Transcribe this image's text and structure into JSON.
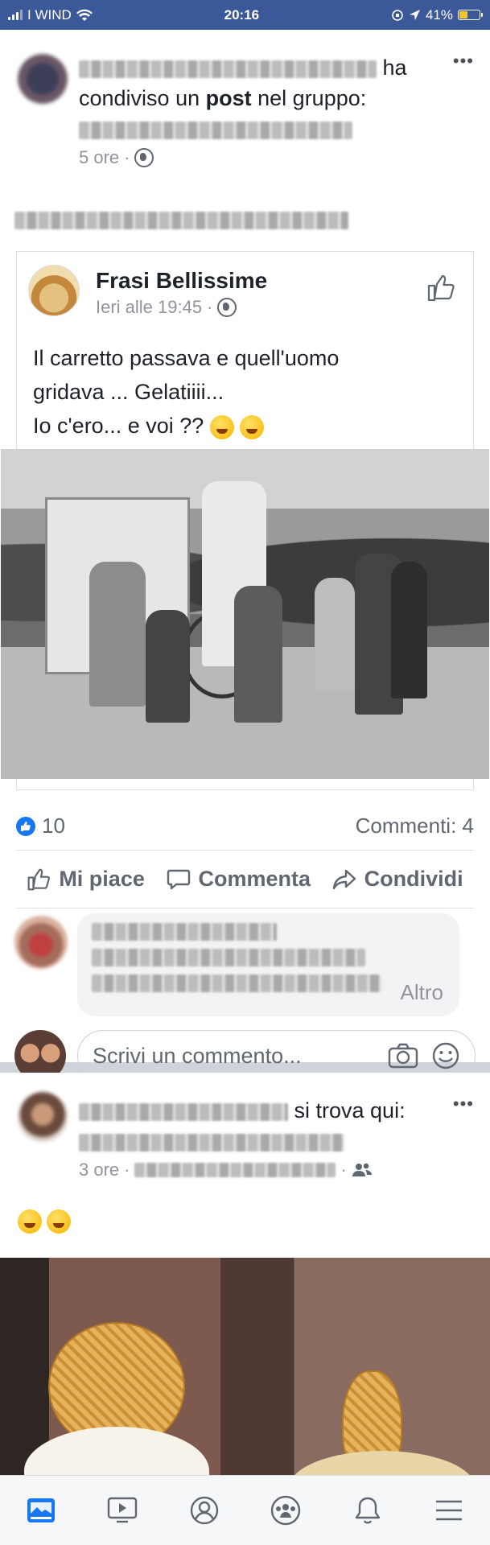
{
  "status_bar": {
    "carrier": "I WIND",
    "time": "20:16",
    "battery": "41%"
  },
  "post1": {
    "shared_action": "ha",
    "shared_line2_prefix": "condiviso un",
    "shared_line2_bold": "post",
    "shared_line2_suffix": "nel gruppo:",
    "time": "5 ore",
    "shared_post": {
      "page_name": "Frasi Bellissime",
      "time": "Ieri alle 19:45",
      "text_line1": "Il carretto passava e quell'uomo",
      "text_line2": "gridava ... Gelatiiii...",
      "text_line3": "Io c'ero... e voi ??"
    },
    "likes_count": "10",
    "comments_count": "Commenti: 4",
    "actions": {
      "like": "Mi piace",
      "comment": "Commenta",
      "share": "Condividi"
    },
    "comment_more": "Altro",
    "write_comment_placeholder": "Scrivi un commento..."
  },
  "post2": {
    "location_text": "si trova qui:",
    "time": "3 ore"
  },
  "tabs": [
    "news-feed",
    "watch",
    "profile",
    "groups",
    "notifications",
    "menu"
  ],
  "colors": {
    "brand": "#3b5998",
    "like_blue": "#1877f2"
  }
}
